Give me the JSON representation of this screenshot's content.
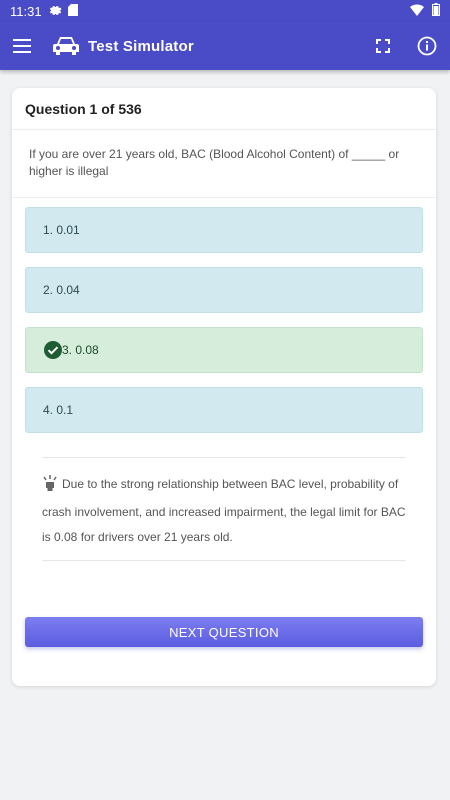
{
  "status_bar": {
    "time": "11:31",
    "icons": [
      "gear-icon",
      "sd-card-icon",
      "wifi-icon",
      "battery-icon"
    ]
  },
  "app_bar": {
    "title": "Test Simulator",
    "icons": [
      "menu-icon",
      "car-icon",
      "fullscreen-icon",
      "info-icon"
    ],
    "color": "#4a4bc6"
  },
  "quiz": {
    "header": "Question 1 of 536",
    "question": "If you are over 21 years old, BAC (Blood Alcohol Content) of _____ or higher is illegal",
    "answers": [
      {
        "label": "1. 0.01",
        "state": "neutral"
      },
      {
        "label": "2. 0.04",
        "state": "neutral"
      },
      {
        "label": "3. 0.08",
        "state": "correct"
      },
      {
        "label": "4. 0.1",
        "state": "neutral"
      }
    ],
    "explanation": "Due to the strong relationship between BAC level, probability of crash involvement, and increased impairment, the legal limit for BAC is 0.08 for drivers over 21 years old.",
    "next_button": "NEXT QUESTION"
  },
  "colors": {
    "answer_neutral": "#d1e9ef",
    "answer_correct": "#d6eddc",
    "check": "#1e5c34",
    "button": "#6566e6"
  }
}
